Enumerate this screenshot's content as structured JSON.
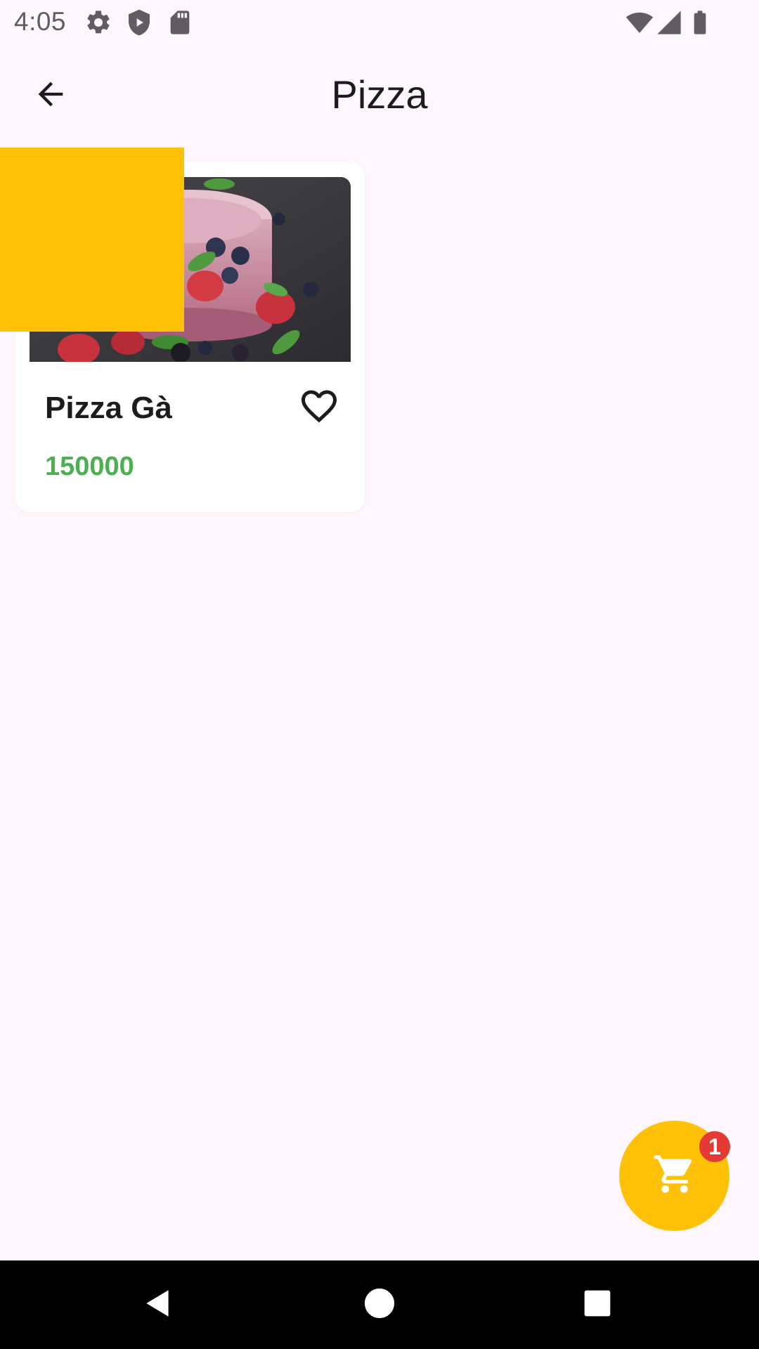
{
  "status_bar": {
    "time": "4:05",
    "icons": [
      "gear-icon",
      "shield-icon",
      "sd-card-icon",
      "wifi-icon",
      "signal-icon",
      "battery-icon"
    ]
  },
  "app_bar": {
    "title": "Pizza",
    "back_icon": "arrow-back-icon"
  },
  "products": [
    {
      "name": "Pizza Gà",
      "price": "150000",
      "favorite_icon": "heart-outline-icon"
    }
  ],
  "cart": {
    "icon": "shopping-cart-icon",
    "badge_count": "1"
  },
  "nav_bar": {
    "buttons": [
      "back-triangle-icon",
      "home-circle-icon",
      "recents-square-icon"
    ]
  },
  "colors": {
    "background": "#fdf7fd",
    "accent": "#ffc107",
    "price": "#4caf50",
    "badge": "#e53935"
  }
}
